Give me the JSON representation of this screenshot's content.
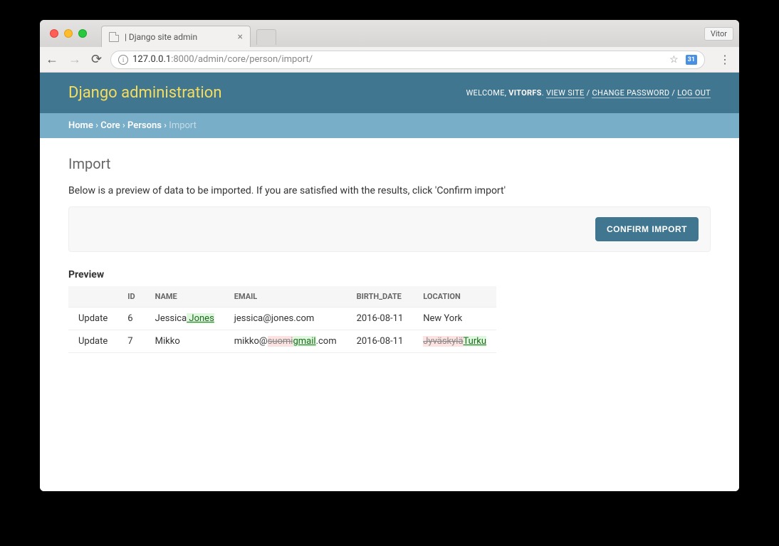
{
  "browser": {
    "tab_title": "| Django site admin",
    "profile_name": "Vitor",
    "url_host": "127.0.0.1",
    "url_port_path": ":8000/admin/core/person/import/",
    "extension_label": "31"
  },
  "header": {
    "site_title": "Django administration",
    "welcome_prefix": "WELCOME, ",
    "username": "VITORFS",
    "view_site": "VIEW SITE",
    "change_password": "CHANGE PASSWORD",
    "log_out": "LOG OUT"
  },
  "breadcrumbs": {
    "home": "Home",
    "app": "Core",
    "model": "Persons",
    "current": "Import",
    "sep": " › "
  },
  "page": {
    "title": "Import",
    "help_text": "Below is a preview of data to be imported. If you are satisfied with the results, click 'Confirm import'",
    "confirm_button": "CONFIRM IMPORT",
    "preview_heading": "Preview"
  },
  "table": {
    "headers": {
      "action": "",
      "id": "ID",
      "name": "NAME",
      "email": "EMAIL",
      "birth_date": "BIRTH_DATE",
      "location": "LOCATION"
    },
    "rows": [
      {
        "action": "Update",
        "id": "6",
        "name_segments": [
          {
            "text": "Jessica",
            "type": "same"
          },
          {
            "text": " Jones",
            "type": "ins"
          }
        ],
        "email_segments": [
          {
            "text": "jessica@jones.com",
            "type": "same"
          }
        ],
        "birth_date": "2016-08-11",
        "location_segments": [
          {
            "text": "New York",
            "type": "same"
          }
        ]
      },
      {
        "action": "Update",
        "id": "7",
        "name_segments": [
          {
            "text": "Mikko",
            "type": "same"
          }
        ],
        "email_segments": [
          {
            "text": "mikko@",
            "type": "same"
          },
          {
            "text": "suomi",
            "type": "del"
          },
          {
            "text": "gmail",
            "type": "ins"
          },
          {
            "text": ".com",
            "type": "same"
          }
        ],
        "birth_date": "2016-08-11",
        "location_segments": [
          {
            "text": "Jyväskylä",
            "type": "del"
          },
          {
            "text": "Turku",
            "type": "ins"
          }
        ]
      }
    ]
  }
}
